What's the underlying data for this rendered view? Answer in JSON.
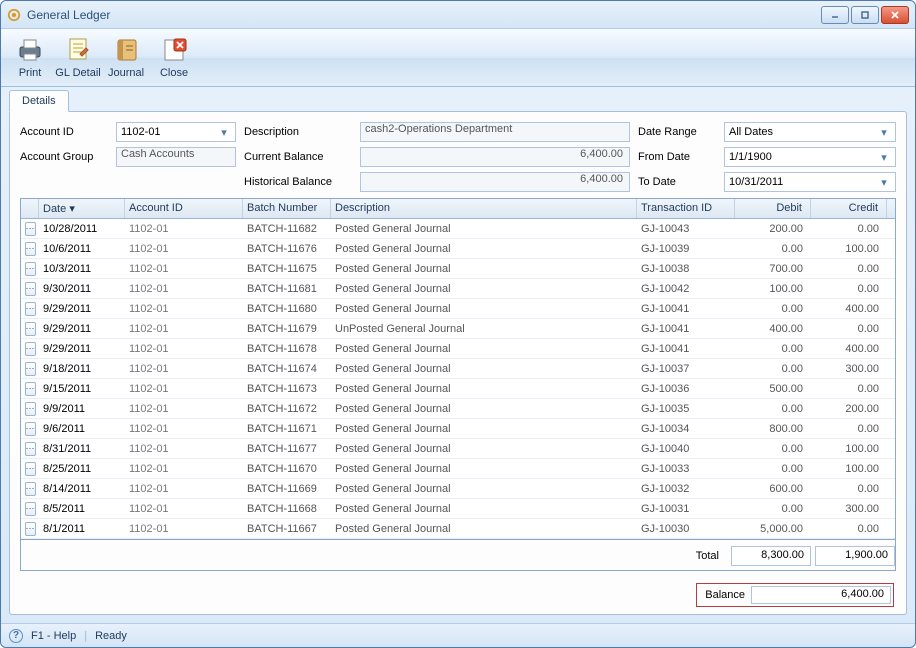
{
  "window": {
    "title": "General Ledger"
  },
  "toolbar": {
    "print": "Print",
    "gl_detail": "GL Detail",
    "journal": "Journal",
    "close": "Close"
  },
  "tabs": {
    "details": "Details"
  },
  "form": {
    "account_id_label": "Account ID",
    "account_id_value": "1102-01",
    "description_label": "Description",
    "description_value": "cash2-Operations Department",
    "date_range_label": "Date Range",
    "date_range_value": "All Dates",
    "account_group_label": "Account Group",
    "account_group_value": "Cash Accounts",
    "current_balance_label": "Current Balance",
    "current_balance_value": "6,400.00",
    "from_date_label": "From Date",
    "from_date_value": "1/1/1900",
    "historical_balance_label": "Historical Balance",
    "historical_balance_value": "6,400.00",
    "to_date_label": "To Date",
    "to_date_value": "10/31/2011"
  },
  "grid": {
    "headers": {
      "date": "Date",
      "account_id": "Account ID",
      "batch": "Batch Number",
      "description": "Description",
      "transaction_id": "Transaction ID",
      "debit": "Debit",
      "credit": "Credit"
    },
    "rows": [
      {
        "date": "10/28/2011",
        "account": "1102-01",
        "batch": "BATCH-11682",
        "desc": "Posted General Journal",
        "txn": "GJ-10043",
        "debit": "200.00",
        "credit": "0.00"
      },
      {
        "date": "10/6/2011",
        "account": "1102-01",
        "batch": "BATCH-11676",
        "desc": "Posted General Journal",
        "txn": "GJ-10039",
        "debit": "0.00",
        "credit": "100.00"
      },
      {
        "date": "10/3/2011",
        "account": "1102-01",
        "batch": "BATCH-11675",
        "desc": "Posted General Journal",
        "txn": "GJ-10038",
        "debit": "700.00",
        "credit": "0.00"
      },
      {
        "date": "9/30/2011",
        "account": "1102-01",
        "batch": "BATCH-11681",
        "desc": "Posted General Journal",
        "txn": "GJ-10042",
        "debit": "100.00",
        "credit": "0.00"
      },
      {
        "date": "9/29/2011",
        "account": "1102-01",
        "batch": "BATCH-11680",
        "desc": "Posted General Journal",
        "txn": "GJ-10041",
        "debit": "0.00",
        "credit": "400.00"
      },
      {
        "date": "9/29/2011",
        "account": "1102-01",
        "batch": "BATCH-11679",
        "desc": "UnPosted General Journal",
        "txn": "GJ-10041",
        "debit": "400.00",
        "credit": "0.00"
      },
      {
        "date": "9/29/2011",
        "account": "1102-01",
        "batch": "BATCH-11678",
        "desc": "Posted General Journal",
        "txn": "GJ-10041",
        "debit": "0.00",
        "credit": "400.00"
      },
      {
        "date": "9/18/2011",
        "account": "1102-01",
        "batch": "BATCH-11674",
        "desc": "Posted General Journal",
        "txn": "GJ-10037",
        "debit": "0.00",
        "credit": "300.00"
      },
      {
        "date": "9/15/2011",
        "account": "1102-01",
        "batch": "BATCH-11673",
        "desc": "Posted General Journal",
        "txn": "GJ-10036",
        "debit": "500.00",
        "credit": "0.00"
      },
      {
        "date": "9/9/2011",
        "account": "1102-01",
        "batch": "BATCH-11672",
        "desc": "Posted General Journal",
        "txn": "GJ-10035",
        "debit": "0.00",
        "credit": "200.00"
      },
      {
        "date": "9/6/2011",
        "account": "1102-01",
        "batch": "BATCH-11671",
        "desc": "Posted General Journal",
        "txn": "GJ-10034",
        "debit": "800.00",
        "credit": "0.00"
      },
      {
        "date": "8/31/2011",
        "account": "1102-01",
        "batch": "BATCH-11677",
        "desc": "Posted General Journal",
        "txn": "GJ-10040",
        "debit": "0.00",
        "credit": "100.00"
      },
      {
        "date": "8/25/2011",
        "account": "1102-01",
        "batch": "BATCH-11670",
        "desc": "Posted General Journal",
        "txn": "GJ-10033",
        "debit": "0.00",
        "credit": "100.00"
      },
      {
        "date": "8/14/2011",
        "account": "1102-01",
        "batch": "BATCH-11669",
        "desc": "Posted General Journal",
        "txn": "GJ-10032",
        "debit": "600.00",
        "credit": "0.00"
      },
      {
        "date": "8/5/2011",
        "account": "1102-01",
        "batch": "BATCH-11668",
        "desc": "Posted General Journal",
        "txn": "GJ-10031",
        "debit": "0.00",
        "credit": "300.00"
      },
      {
        "date": "8/1/2011",
        "account": "1102-01",
        "batch": "BATCH-11667",
        "desc": "Posted General Journal",
        "txn": "GJ-10030",
        "debit": "5,000.00",
        "credit": "0.00"
      }
    ],
    "totals": {
      "label": "Total",
      "debit": "8,300.00",
      "credit": "1,900.00"
    },
    "balance": {
      "label": "Balance",
      "value": "6,400.00"
    }
  },
  "statusbar": {
    "help": "F1 - Help",
    "ready": "Ready"
  }
}
